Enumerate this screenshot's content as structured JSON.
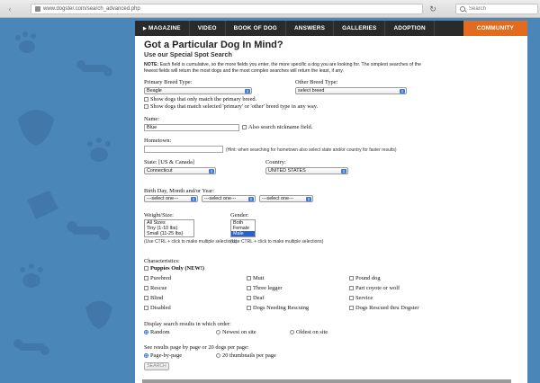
{
  "browser": {
    "url": "www.dogster.com/search_advanced.php",
    "search_placeholder": "Search"
  },
  "nav": {
    "items": [
      "MAGAZINE",
      "VIDEO",
      "BOOK OF DOG",
      "ANSWERS",
      "GALLERIES",
      "ADOPTION"
    ],
    "community": "COMMUNITY"
  },
  "page": {
    "title": "Got a Particular Dog In Mind?",
    "subtitle": "Use our Special Spot Search",
    "note_label": "NOTE:",
    "note_text": "Each field is cumulative, so the more fields you enter, the more specific a dog you are looking for. The simplest searches of the fewest fields will return the most dogs and the most complex searches will return the least, if any."
  },
  "form": {
    "primary_breed": {
      "label": "Primary Breed Type:",
      "value": "Beagle"
    },
    "other_breed": {
      "label": "Other Breed Type:",
      "value": "select breed"
    },
    "breed_options": [
      "Show dogs that only match the primary breed.",
      "Show dogs that match selected 'primary' or 'other' breed type in any way."
    ],
    "name": {
      "label": "Name:",
      "value": "Blue",
      "nickname_label": "Also search nickname field."
    },
    "hometown": {
      "label": "Hometown:",
      "value": "",
      "hint": "(Hint: when searching for hometown also select state and/or country for faster results)"
    },
    "state": {
      "label": "State: [US & Canada]",
      "value": "Connecticut"
    },
    "country": {
      "label": "Country:",
      "value": "UNITED STATES"
    },
    "birthday": {
      "label": "Birth Day, Month and/or Year:",
      "selects": [
        "---select one---",
        "---select one---",
        "---select one---"
      ]
    },
    "weight": {
      "label": "Weight/Size:",
      "options": [
        "All Sizes",
        "Tiny (1-10 lbs)",
        "Small (11-25 lbs)"
      ],
      "hint": "(Use CTRL + click to make multiple selections)"
    },
    "gender": {
      "label": "Gender:",
      "options": [
        "Both",
        "Female",
        "Male"
      ],
      "selected": "Male",
      "hint": "(Use CTRL + click to make multiple selections)"
    },
    "characteristics": {
      "label": "Characteristics:",
      "puppies": "Puppies Only (NEW!)",
      "col1": [
        "Purebred",
        "Rescue",
        "Blind",
        "Disabled"
      ],
      "col2": [
        "Mutt",
        "Three legger",
        "Deaf",
        "Dogs Needing Rescuing"
      ],
      "col3": [
        "Pound dog",
        "Part coyote or wolf",
        "Service",
        "Dogs Rescued thru Dogster"
      ]
    },
    "order": {
      "label": "Display search results in which order:",
      "options": [
        "Random",
        "Newest on site",
        "Oldest on site"
      ],
      "selected": "Random"
    },
    "paging": {
      "label": "See results page by page or 20 dogs per page:",
      "options": [
        "Page-by-page",
        "20 thumbnails per page"
      ],
      "selected": "Page-by-page"
    },
    "submit": "SEARCH"
  },
  "colors": {
    "background": "#4a86b8",
    "nav": "#2a2a2a",
    "community": "#e46a1e",
    "select_accent": "#3d7bd8"
  }
}
